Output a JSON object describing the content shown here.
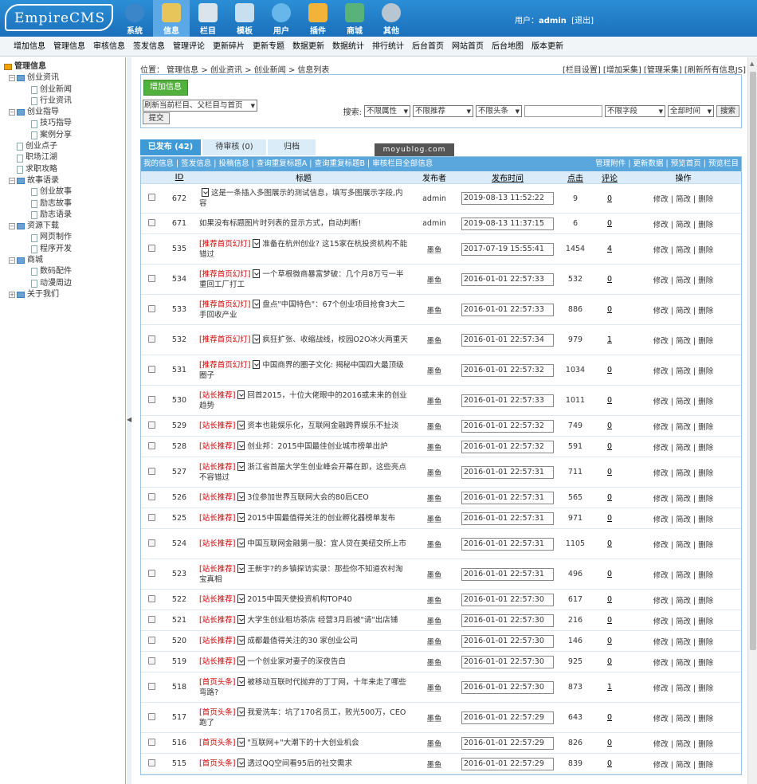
{
  "app": {
    "logo": "EmpireCMS"
  },
  "nav": [
    {
      "label": "系统",
      "icon": "globe-icon",
      "color": "#3a86c8"
    },
    {
      "label": "信息",
      "icon": "notepad-edit-icon",
      "color": "#e8c55a"
    },
    {
      "label": "栏目",
      "icon": "folder-icon",
      "color": "#d9e4ec"
    },
    {
      "label": "模板",
      "icon": "template-window-icon",
      "color": "#c8dff0"
    },
    {
      "label": "用户",
      "icon": "user-icon",
      "color": "#67b7ea"
    },
    {
      "label": "插件",
      "icon": "tools-icon",
      "color": "#f2b33a"
    },
    {
      "label": "商城",
      "icon": "shop-card-icon",
      "color": "#58b27a"
    },
    {
      "label": "其他",
      "icon": "gear-icon",
      "color": "#b8c6d2"
    }
  ],
  "user": {
    "prefix": "用户：",
    "name": "admin",
    "logout": "[退出]"
  },
  "subnav": [
    "增加信息",
    "管理信息",
    "审核信息",
    "签发信息",
    "管理评论",
    "更新碎片",
    "更新专题",
    "数据更新",
    "数据统计",
    "排行统计",
    "后台首页",
    "网站首页",
    "后台地图",
    "版本更新"
  ],
  "sidebar": {
    "root": "管理信息",
    "tree": [
      {
        "label": "创业资讯",
        "level": 0,
        "type": "folder"
      },
      {
        "label": "创业新闻",
        "level": 1,
        "type": "page"
      },
      {
        "label": "行业资讯",
        "level": 1,
        "type": "page"
      },
      {
        "label": "创业指导",
        "level": 0,
        "type": "folder"
      },
      {
        "label": "技巧指导",
        "level": 1,
        "type": "page"
      },
      {
        "label": "案例分享",
        "level": 1,
        "type": "page"
      },
      {
        "label": "创业点子",
        "level": 0,
        "type": "page"
      },
      {
        "label": "职场江湖",
        "level": 0,
        "type": "page"
      },
      {
        "label": "求职攻略",
        "level": 0,
        "type": "page"
      },
      {
        "label": "故事语录",
        "level": 0,
        "type": "folder"
      },
      {
        "label": "创业故事",
        "level": 1,
        "type": "page"
      },
      {
        "label": "励志故事",
        "level": 1,
        "type": "page"
      },
      {
        "label": "励志语录",
        "level": 1,
        "type": "page"
      },
      {
        "label": "资源下载",
        "level": 0,
        "type": "folder"
      },
      {
        "label": "网页制作",
        "level": 1,
        "type": "page"
      },
      {
        "label": "程序开发",
        "level": 1,
        "type": "page"
      },
      {
        "label": "商城",
        "level": 0,
        "type": "folder"
      },
      {
        "label": "数码配件",
        "level": 1,
        "type": "page"
      },
      {
        "label": "动漫周边",
        "level": 1,
        "type": "page"
      },
      {
        "label": "关于我们",
        "level": 0,
        "type": "folder-closed"
      }
    ]
  },
  "breadcrumb": "位置： 管理信息 > 创业资讯 > 创业新闻 > 信息列表",
  "toplinks": "[栏目设置] [增加采集] [管理采集] [刷新所有信息JS]",
  "toolbox": {
    "add_label": "增加信息",
    "refresh_option": "刷新当前栏目、父栏目与首页",
    "submit_label": "提交",
    "search_label": "搜索:",
    "filters": [
      "不限属性",
      "不限推荐",
      "不限头条"
    ],
    "field_option": "不限字段",
    "time_option": "全部时间",
    "search_button": "搜索"
  },
  "tabs": [
    {
      "label": "已发布 (42)",
      "active": true
    },
    {
      "label": "待审核 (0)",
      "active": false
    },
    {
      "label": "归档",
      "active": false
    }
  ],
  "watermark": "moyublog.com",
  "actionbar": {
    "left": "我的信息 | 签发信息 | 投稿信息 | 查询重复标题A | 查询重复标题B | 审核栏目全部信息",
    "right": "管理附件 | 更新数据 | 预览首页 | 预览栏目"
  },
  "columns": [
    "ID",
    "标题",
    "发布者",
    "发布时间",
    "点击",
    "评论",
    "操作"
  ],
  "ops": "修改 | 简改 | 删除",
  "rows": [
    {
      "id": "672",
      "tag": "",
      "title": "这是一条插入多图展示的测试信息，填写多图展示字段,内容",
      "icon_first": true,
      "publisher": "admin",
      "time": "2019-08-13 11:52:22",
      "clicks": "9",
      "comments": "0",
      "h": 37
    },
    {
      "id": "671",
      "tag": "",
      "title": "如果没有标题图片时列表的显示方式，自动判断!",
      "icon_first": false,
      "noicon": true,
      "publisher": "admin",
      "time": "2019-08-13 11:37:15",
      "clicks": "6",
      "comments": "0",
      "h": 26
    },
    {
      "id": "535",
      "tag": "[推荐首页幻灯]",
      "title": "准备在杭州创业? 这15家在杭投资机构不能错过",
      "publisher": "墨鱼",
      "time": "2017-07-19 15:55:41",
      "clicks": "1454",
      "comments": "4",
      "h": 38
    },
    {
      "id": "534",
      "tag": "[推荐首页幻灯]",
      "title": "一个草根微商暴富梦破：几个月8万亏一半 重回工厂打工",
      "publisher": "墨鱼",
      "time": "2016-01-01 22:57:33",
      "clicks": "532",
      "comments": "0",
      "h": 38
    },
    {
      "id": "533",
      "tag": "[推荐首页幻灯]",
      "title": "盘点\"中国特色\"：67个创业项目抢食3大二手回收产业",
      "publisher": "墨鱼",
      "time": "2016-01-01 22:57:33",
      "clicks": "886",
      "comments": "0",
      "h": 38
    },
    {
      "id": "532",
      "tag": "[推荐首页幻灯]",
      "title": "疯狂扩张、收缩战线，校园O2O冰火两重天",
      "publisher": "墨鱼",
      "time": "2016-01-01 22:57:34",
      "clicks": "979",
      "comments": "1",
      "h": 38
    },
    {
      "id": "531",
      "tag": "[推荐首页幻灯]",
      "title": "中国商界的圈子文化: 揭秘中国四大最顶级圈子",
      "publisher": "墨鱼",
      "time": "2016-01-01 22:57:32",
      "clicks": "1034",
      "comments": "0",
      "h": 38
    },
    {
      "id": "530",
      "tag": "[站长推荐]",
      "title": "回首2015，十位大佬眼中的2016或未来的创业趋势",
      "publisher": "墨鱼",
      "time": "2016-01-01 22:57:33",
      "clicks": "1011",
      "comments": "0",
      "h": 38
    },
    {
      "id": "529",
      "tag": "[站长推荐]",
      "title": "资本也能娱乐化，互联网金融跨界娱乐不扯淡",
      "publisher": "墨鱼",
      "time": "2016-01-01 22:57:32",
      "clicks": "749",
      "comments": "0",
      "h": 26
    },
    {
      "id": "528",
      "tag": "[站长推荐]",
      "title": "创业邦：2015中国最佳创业城市榜单出炉",
      "publisher": "墨鱼",
      "time": "2016-01-01 22:57:32",
      "clicks": "591",
      "comments": "0",
      "h": 26
    },
    {
      "id": "527",
      "tag": "[站长推荐]",
      "title": "浙江省首届大学生创业峰会开幕在即，这些亮点不容错过",
      "publisher": "墨鱼",
      "time": "2016-01-01 22:57:31",
      "clicks": "711",
      "comments": "0",
      "h": 38
    },
    {
      "id": "526",
      "tag": "[站长推荐]",
      "title": "3位参加世界互联网大会的80后CEO",
      "publisher": "墨鱼",
      "time": "2016-01-01 22:57:31",
      "clicks": "565",
      "comments": "0",
      "h": 26
    },
    {
      "id": "525",
      "tag": "[站长推荐]",
      "title": "2015中国最值得关注的创业孵化器榜单发布",
      "publisher": "墨鱼",
      "time": "2016-01-01 22:57:31",
      "clicks": "971",
      "comments": "0",
      "h": 26
    },
    {
      "id": "524",
      "tag": "[站长推荐]",
      "title": "中国互联网金融第一股：宜人贷在美纽交所上市",
      "publisher": "墨鱼",
      "time": "2016-01-01 22:57:31",
      "clicks": "1105",
      "comments": "0",
      "h": 38
    },
    {
      "id": "523",
      "tag": "[站长推荐]",
      "title": "王新宇?的乡镇探访实录：那些你不知道农村淘宝真相",
      "publisher": "墨鱼",
      "time": "2016-01-01 22:57:31",
      "clicks": "496",
      "comments": "0",
      "h": 38
    },
    {
      "id": "522",
      "tag": "[站长推荐]",
      "title": "2015中国天使投资机构TOP40",
      "publisher": "墨鱼",
      "time": "2016-01-01 22:57:30",
      "clicks": "617",
      "comments": "0",
      "h": 26
    },
    {
      "id": "521",
      "tag": "[站长推荐]",
      "title": "大学生创业租坊茶店 经营3月后被\"请\"出店铺",
      "publisher": "墨鱼",
      "time": "2016-01-01 22:57:30",
      "clicks": "216",
      "comments": "0",
      "h": 26
    },
    {
      "id": "520",
      "tag": "[站长推荐]",
      "title": "成都最值得关注的30 家创业公司",
      "publisher": "墨鱼",
      "time": "2016-01-01 22:57:30",
      "clicks": "146",
      "comments": "0",
      "h": 26
    },
    {
      "id": "519",
      "tag": "[站长推荐]",
      "title": "一个创业家对妻子的深夜告白",
      "publisher": "墨鱼",
      "time": "2016-01-01 22:57:30",
      "clicks": "925",
      "comments": "0",
      "h": 26
    },
    {
      "id": "518",
      "tag": "[首页头条]",
      "title": "被移动互联时代抛弃的丁丁网，十年来走了哪些弯路?",
      "publisher": "墨鱼",
      "time": "2016-01-01 22:57:30",
      "clicks": "873",
      "comments": "1",
      "h": 38
    },
    {
      "id": "517",
      "tag": "[首页头条]",
      "title": "我爱洗车：坑了170名员工，败光500万，CEO跑了",
      "publisher": "墨鱼",
      "time": "2016-01-01 22:57:29",
      "clicks": "643",
      "comments": "0",
      "h": 38
    },
    {
      "id": "516",
      "tag": "[首页头条]",
      "title": "\"互联网+\"大潮下的十大创业机会",
      "publisher": "墨鱼",
      "time": "2016-01-01 22:57:29",
      "clicks": "826",
      "comments": "0",
      "h": 26
    },
    {
      "id": "515",
      "tag": "[首页头条]",
      "title": "透过QQ空间看95后的社交需求",
      "publisher": "墨鱼",
      "time": "2016-01-01 22:57:29",
      "clicks": "839",
      "comments": "0",
      "h": 26
    }
  ]
}
